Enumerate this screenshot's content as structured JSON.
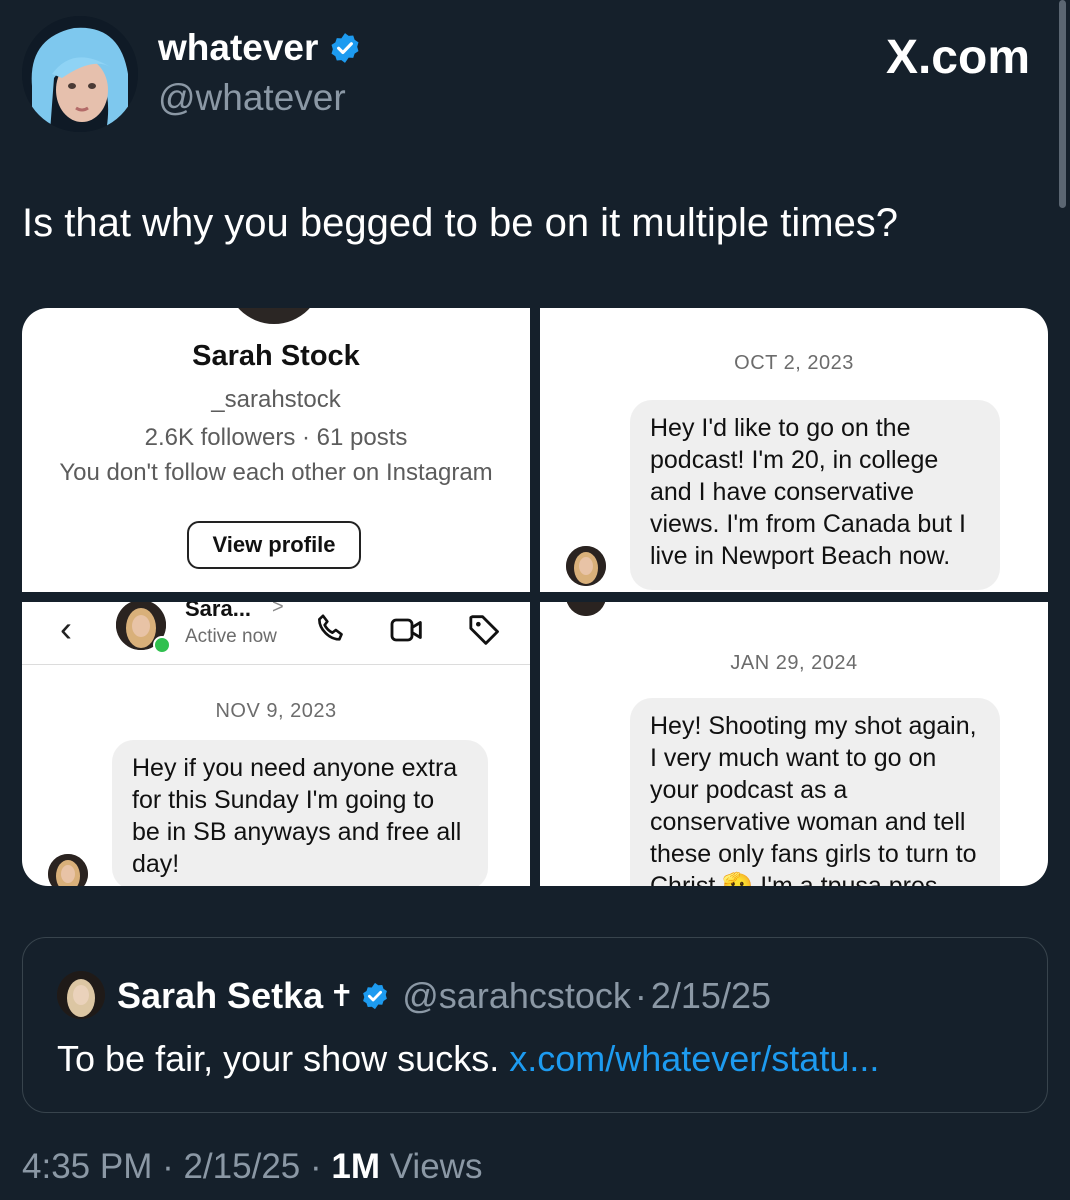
{
  "author": {
    "display_name": "whatever",
    "handle": "@whatever",
    "verified_color": "#1d9bf0"
  },
  "brand": "X.com",
  "tweet": {
    "text": "Is that why you begged to be on it multiple times?"
  },
  "media": {
    "profile_card": {
      "name": "Sarah Stock",
      "username": "_sarahstock",
      "stats": "2.6K followers · 61 posts",
      "follow_status": "You don't follow each other on Instagram",
      "button": "View profile"
    },
    "dm1": {
      "date": "OCT 2, 2023",
      "message": "Hey I'd like to go on the podcast! I'm 20, in college and I have conservative views. I'm from Canada but I live in Newport Beach now."
    },
    "dm2": {
      "header_name": "Sara...",
      "header_chevron": ">",
      "header_status": "Active now",
      "date": "NOV 9, 2023",
      "message": "Hey if you need anyone extra for this Sunday I'm going to be in SB anyways and free all day!"
    },
    "dm3": {
      "date": "JAN 29, 2024",
      "message": "Hey! Shooting my shot again, I very much want to go on your podcast as a conservative woman and tell these only fans girls to turn to Christ 🫡 I'm a tpusa pres"
    }
  },
  "quote": {
    "display_name": "Sarah Setka",
    "name_emoji": "✝",
    "handle": "@sarahcstock",
    "separator": "·",
    "date": "2/15/25",
    "text": "To be fair, your show sucks. ",
    "link": "x.com/whatever/statu..."
  },
  "footer": {
    "time": "4:35 PM",
    "sep1": " · ",
    "date": "2/15/25",
    "sep2": " · ",
    "views_count": "1M",
    "views_label": " Views"
  }
}
